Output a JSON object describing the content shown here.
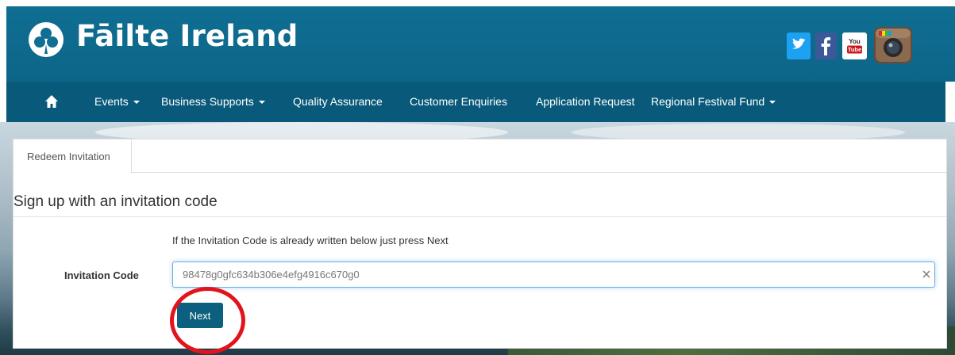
{
  "brand": {
    "name": "Fāilte Ireland"
  },
  "social": [
    {
      "name": "twitter-icon"
    },
    {
      "name": "facebook-icon"
    },
    {
      "name": "youtube-icon",
      "label_top": "You",
      "label_bottom": "Tube"
    },
    {
      "name": "instagram-icon"
    }
  ],
  "nav": {
    "items": [
      {
        "label": "Events",
        "dropdown": true
      },
      {
        "label": "Business Supports",
        "dropdown": true
      },
      {
        "label": "Quality Assurance",
        "dropdown": false
      },
      {
        "label": "Customer Enquiries",
        "dropdown": false
      },
      {
        "label": "Application Request",
        "dropdown": false
      },
      {
        "label": "Regional Festival Fund",
        "dropdown": true
      }
    ]
  },
  "tabs": [
    {
      "label": "Redeem Invitation",
      "active": true
    }
  ],
  "form": {
    "title": "Sign up with an invitation code",
    "help": "If the Invitation Code is already written below just press Next",
    "code_label": "Invitation Code",
    "code_value": "98478g0gfc634b306e4efg4916c670g0",
    "next_label": "Next"
  },
  "colors": {
    "header_bg": "#0f6e92",
    "nav_bg": "#095a7a",
    "button_bg": "#0c5f7e",
    "annotation": "#e3131b"
  }
}
